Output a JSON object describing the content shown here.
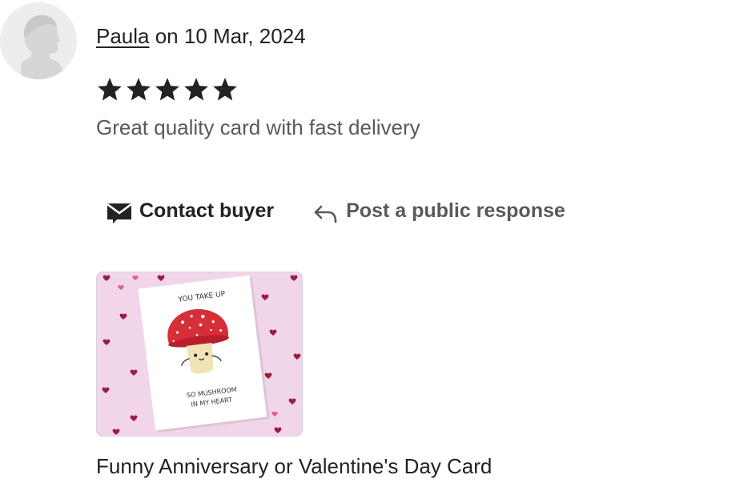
{
  "review": {
    "reviewer_name": "Paula",
    "date_text": " on 10 Mar, 2024",
    "rating": 5,
    "text": "Great quality card with fast delivery"
  },
  "actions": {
    "contact_label": "Contact buyer",
    "respond_label": "Post a public response"
  },
  "product": {
    "card_line1": "YOU TAKE UP",
    "card_line2": "SO MUSHROOM",
    "card_line3": "IN MY HEART",
    "title": "Funny Anniversary or Valentine's Day Card"
  },
  "colors": {
    "star": "#222222",
    "muted_text": "#595959",
    "card_background": "#f1d6e9",
    "heart": "#9b1b3b",
    "mushroom_cap": "#d62f38"
  },
  "icons": {
    "avatar": "default-avatar-icon",
    "star": "star-icon",
    "contact": "envelope-icon",
    "respond": "reply-arrow-icon"
  }
}
